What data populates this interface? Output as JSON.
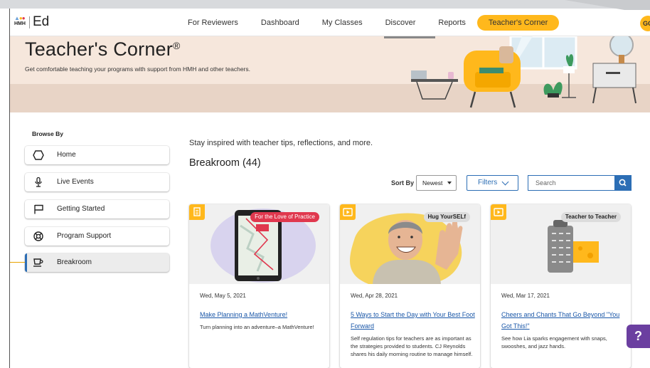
{
  "header": {
    "logo_hmh": "HMH",
    "logo_ed": "Ed",
    "nav": [
      "For Reviewers",
      "Dashboard",
      "My Classes",
      "Discover",
      "Reports",
      "Teacher's Corner"
    ],
    "active_nav": "Teacher's Corner",
    "avatar_initials": "GC"
  },
  "banner": {
    "title": "Teacher's Corner",
    "registered_mark": "®",
    "subtitle": "Get comfortable teaching your programs with support from HMH and other teachers."
  },
  "sidebar": {
    "label": "Browse By",
    "items": [
      {
        "label": "Home",
        "icon": "home-icon"
      },
      {
        "label": "Live Events",
        "icon": "microphone-icon"
      },
      {
        "label": "Getting Started",
        "icon": "flag-icon"
      },
      {
        "label": "Program Support",
        "icon": "support-icon"
      },
      {
        "label": "Breakroom",
        "icon": "coffee-cup-icon"
      }
    ],
    "active_item": "Breakroom"
  },
  "main": {
    "intro": "Stay inspired with teacher tips, reflections, and more.",
    "section_title": "Breakroom (44)",
    "sort_label": "Sort By",
    "sort_value": "Newest",
    "filters_label": "Filters",
    "search_placeholder": "Search"
  },
  "cards": [
    {
      "type_icon": "document-icon",
      "tag": "For the Love of Practice",
      "date": "Wed, May 5, 2021",
      "title": "Make Planning a MathVenture!",
      "description": "Turn planning into an adventure–a MathVenture!"
    },
    {
      "type_icon": "video-play-icon",
      "tag": "Hug YourSELf",
      "date": "Wed, Apr 28, 2021",
      "title": "5 Ways to Start the Day with Your Best Foot Forward",
      "description": "Self regulation tips for teachers are as important as the strategies provided to students. CJ Reynolds shares his daily morning routine to manage himself."
    },
    {
      "type_icon": "video-play-icon",
      "tag": "Teacher to Teacher",
      "date": "Wed, Mar 17, 2021",
      "title": "Cheers and Chants That Go Beyond \"You Got This!\"",
      "description": "See how Lia sparks engagement with snaps, swooshes, and jazz hands."
    }
  ],
  "help_label": "?",
  "colors": {
    "accent": "#ffb81c",
    "link": "#1a57a8",
    "primary": "#2c6eb5",
    "banner_bg": "#f6e7dc",
    "tag_red": "#e0384e",
    "help": "#6b3fa0"
  }
}
